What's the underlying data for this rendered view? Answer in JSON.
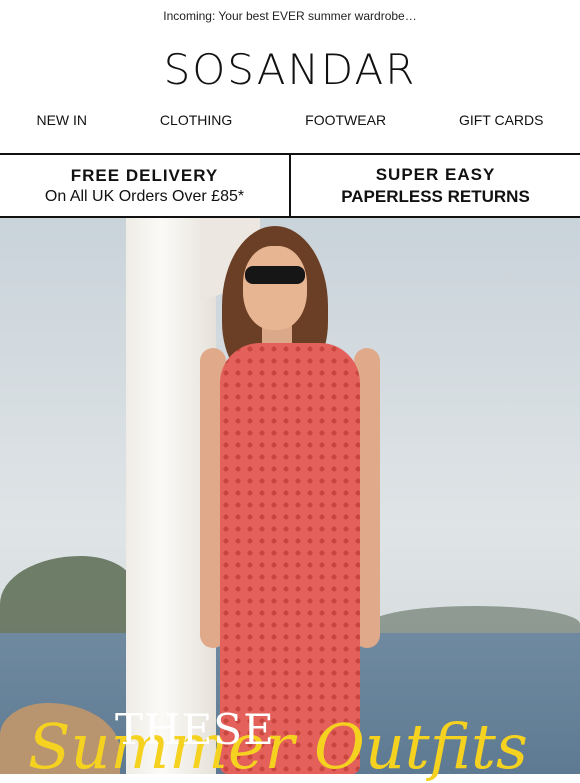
{
  "preheader": {
    "text": "Incoming: Your best EVER summer wardrobe…"
  },
  "brand": {
    "logo_text": "SOSANDAR"
  },
  "nav": {
    "items": [
      {
        "label": "NEW IN"
      },
      {
        "label": "CLOTHING"
      },
      {
        "label": "FOOTWEAR"
      },
      {
        "label": "GIFT CARDS"
      }
    ]
  },
  "promo": {
    "left": {
      "title": "FREE DELIVERY",
      "subtitle": "On All UK Orders Over £85*"
    },
    "right": {
      "title": "SUPER EASY",
      "subtitle": "PAPERLESS RETURNS"
    }
  },
  "hero": {
    "headline": "THESE",
    "script_text": "Summer Outfits",
    "accent_color": "#f5d21f",
    "dress_color": "#e4605a"
  }
}
